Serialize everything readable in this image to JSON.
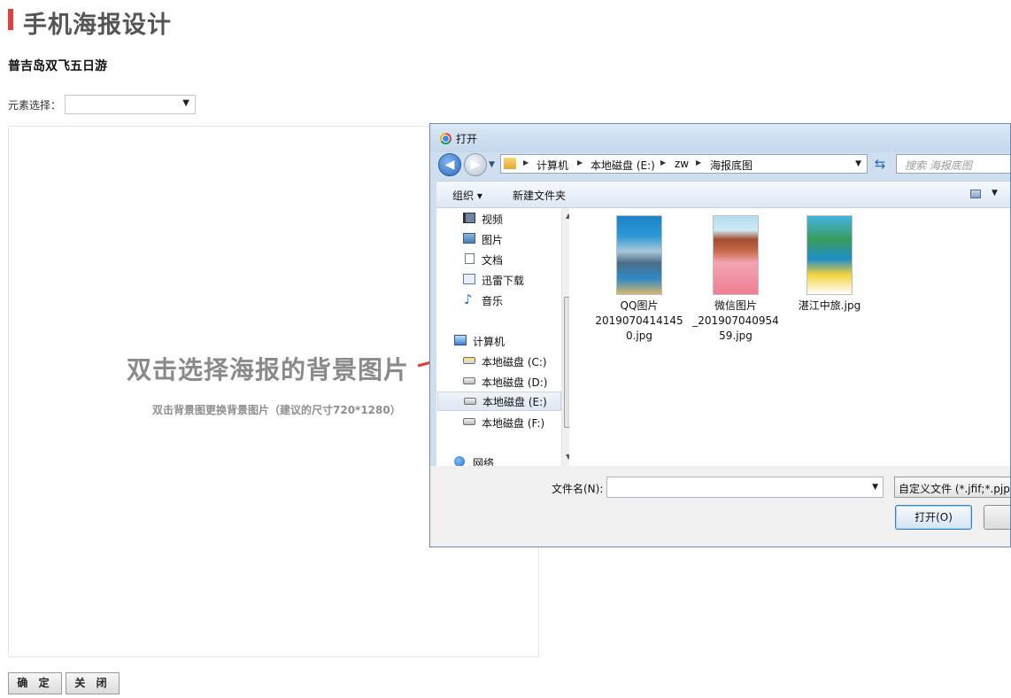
{
  "page": {
    "title": "手机海报设计",
    "subtitle": "普吉岛双飞五日游",
    "element_label": "元素选择：",
    "element_select_value": "",
    "poster_main": "双击选择海报的背景图片",
    "poster_hint": "双击背景图更换背景图片（建议的尺寸720*1280）",
    "buttons": {
      "ok": "确 定",
      "close": "关 闭"
    },
    "accent_color": "#e2403a"
  },
  "dialog": {
    "title": "打开",
    "breadcrumb": [
      "计算机",
      "本地磁盘 (E:)",
      "zw",
      "海报底图"
    ],
    "search_placeholder": "搜索 海报底图",
    "toolbar": {
      "organize": "组织 ▾",
      "new_folder": "新建文件夹"
    },
    "nav": [
      {
        "label": "视频",
        "icon": "video-icon"
      },
      {
        "label": "图片",
        "icon": "pictures-icon"
      },
      {
        "label": "文档",
        "icon": "documents-icon"
      },
      {
        "label": "迅雷下载",
        "icon": "download-icon"
      },
      {
        "label": "音乐",
        "icon": "music-icon"
      },
      {
        "label": "计算机",
        "icon": "computer-icon"
      },
      {
        "label": "本地磁盘 (C:)",
        "icon": "drive-icon"
      },
      {
        "label": "本地磁盘 (D:)",
        "icon": "drive-icon"
      },
      {
        "label": "本地磁盘 (E:)",
        "icon": "drive-icon",
        "selected": true
      },
      {
        "label": "本地磁盘 (F:)",
        "icon": "drive-icon"
      },
      {
        "label": "网络",
        "icon": "network-icon"
      }
    ],
    "files": [
      {
        "name_lines": [
          "QQ图片",
          "2019070414145",
          "0.jpg"
        ]
      },
      {
        "name_lines": [
          "微信图片",
          "_201907040954",
          "59.jpg"
        ]
      },
      {
        "name_lines": [
          "湛江中旅.jpg"
        ]
      }
    ],
    "filename_label": "文件名(N):",
    "filename_value": "",
    "file_type": "自定义文件 (*.jfif;*.pjpeg",
    "open_button": "打开(O)",
    "cancel_button": ""
  }
}
